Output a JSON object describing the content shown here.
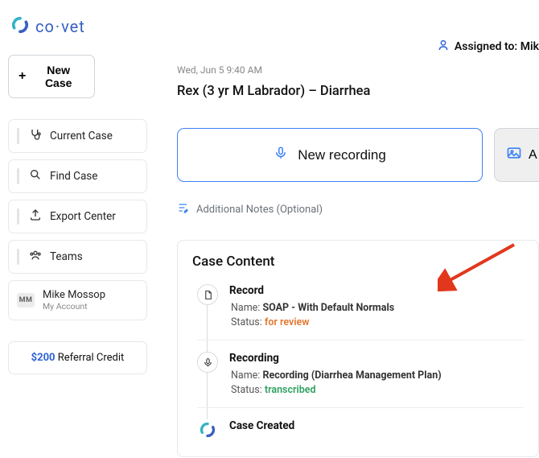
{
  "brand": {
    "name": "co·vet"
  },
  "sidebar": {
    "new_case": "New Case",
    "items": [
      {
        "label": "Current Case"
      },
      {
        "label": "Find Case"
      },
      {
        "label": "Export Center"
      },
      {
        "label": "Teams"
      }
    ],
    "user": {
      "initials": "MM",
      "name": "Mike Mossop",
      "sub": "My Account"
    },
    "referral": {
      "amount": "$200",
      "rest": " Referral Credit"
    }
  },
  "header": {
    "assigned_label": "Assigned to: ",
    "assigned_name": "Mik"
  },
  "case": {
    "timestamp": "Wed, Jun 5 9:40 AM",
    "title": "Rex (3 yr M Labrador) – Diarrhea"
  },
  "actions": {
    "new_recording": "New recording",
    "side_btn_partial": "A",
    "additional_notes": "Additional Notes (Optional)"
  },
  "content": {
    "heading": "Case Content",
    "labels": {
      "name": "Name: ",
      "status": "Status: "
    },
    "items": [
      {
        "title": "Record",
        "name": "SOAP - With Default Normals",
        "status": "for review",
        "status_kind": "review"
      },
      {
        "title": "Recording",
        "name": "Recording (Diarrhea Management Plan)",
        "status": "transcribed",
        "status_kind": "transcribed"
      },
      {
        "title": "Case Created"
      }
    ]
  }
}
